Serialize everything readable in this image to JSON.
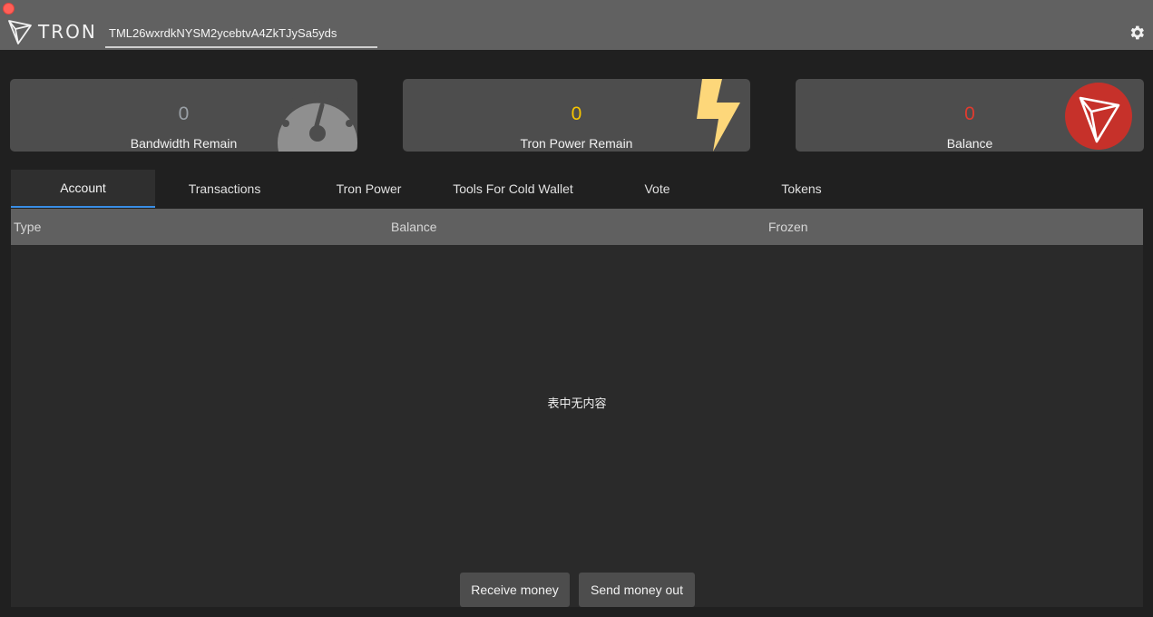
{
  "app": {
    "logo_text": "TRON",
    "address": "TML26wxrdkNYSM2ycebtvA4ZkTJySa5yds"
  },
  "icons": {
    "close": "close-dot",
    "logo": "tron-logo-icon",
    "settings": "gear-icon",
    "bandwidth": "speedometer-icon",
    "power": "lightning-icon",
    "balance": "tron-coin-icon"
  },
  "colors": {
    "bandwidth_value": "#9aa0a6",
    "power_value": "#f5c400",
    "balance_value": "#e03b2f",
    "tron_red": "#c6312a",
    "tab_indicator": "#3a8ee6"
  },
  "cards": [
    {
      "value": "0",
      "label": "Bandwidth Remain"
    },
    {
      "value": "0",
      "label": "Tron Power Remain"
    },
    {
      "value": "0",
      "label": "Balance"
    }
  ],
  "tabs": [
    {
      "label": "Account",
      "active": true
    },
    {
      "label": "Transactions",
      "active": false
    },
    {
      "label": "Tron Power",
      "active": false
    },
    {
      "label": "Tools For Cold Wallet",
      "active": false
    },
    {
      "label": "Vote",
      "active": false
    },
    {
      "label": "Tokens",
      "active": false
    }
  ],
  "table": {
    "columns": [
      "Type",
      "Balance",
      "Frozen"
    ],
    "empty_text": "表中无内容"
  },
  "actions": {
    "receive": "Receive money",
    "send": "Send money out"
  }
}
